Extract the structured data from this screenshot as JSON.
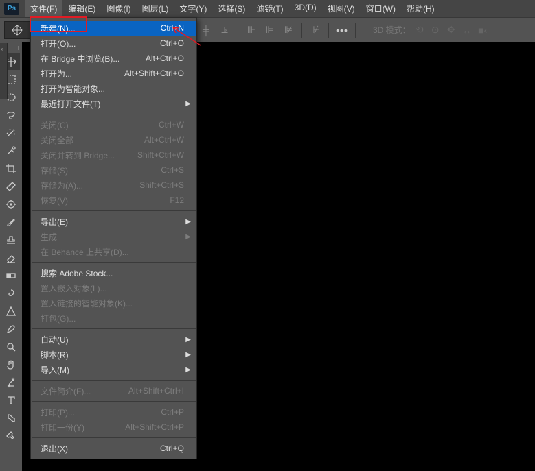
{
  "logo": "Ps",
  "menubar": [
    "文件(F)",
    "编辑(E)",
    "图像(I)",
    "图层(L)",
    "文字(Y)",
    "选择(S)",
    "滤镜(T)",
    "3D(D)",
    "视图(V)",
    "窗口(W)",
    "帮助(H)"
  ],
  "mode3d_label": "3D 模式：",
  "file_menu": {
    "groups": [
      [
        {
          "l": "新建(N)...",
          "s": "Ctrl+N",
          "hover": true
        },
        {
          "l": "打开(O)...",
          "s": "Ctrl+O"
        },
        {
          "l": "在 Bridge 中浏览(B)...",
          "s": "Alt+Ctrl+O"
        },
        {
          "l": "打开为...",
          "s": "Alt+Shift+Ctrl+O"
        },
        {
          "l": "打开为智能对象..."
        },
        {
          "l": "最近打开文件(T)",
          "sub": true
        }
      ],
      [
        {
          "l": "关闭(C)",
          "s": "Ctrl+W",
          "dis": true
        },
        {
          "l": "关闭全部",
          "s": "Alt+Ctrl+W",
          "dis": true
        },
        {
          "l": "关闭并转到 Bridge...",
          "s": "Shift+Ctrl+W",
          "dis": true
        },
        {
          "l": "存储(S)",
          "s": "Ctrl+S",
          "dis": true
        },
        {
          "l": "存储为(A)...",
          "s": "Shift+Ctrl+S",
          "dis": true
        },
        {
          "l": "恢复(V)",
          "s": "F12",
          "dis": true
        }
      ],
      [
        {
          "l": "导出(E)",
          "sub": true
        },
        {
          "l": "生成",
          "sub": true,
          "dis": true
        },
        {
          "l": "在 Behance 上共享(D)...",
          "dis": true
        }
      ],
      [
        {
          "l": "搜索 Adobe Stock..."
        },
        {
          "l": "置入嵌入对象(L)...",
          "dis": true
        },
        {
          "l": "置入链接的智能对象(K)...",
          "dis": true
        },
        {
          "l": "打包(G)...",
          "dis": true
        }
      ],
      [
        {
          "l": "自动(U)",
          "sub": true
        },
        {
          "l": "脚本(R)",
          "sub": true
        },
        {
          "l": "导入(M)",
          "sub": true
        }
      ],
      [
        {
          "l": "文件简介(F)...",
          "s": "Alt+Shift+Ctrl+I",
          "dis": true
        }
      ],
      [
        {
          "l": "打印(P)...",
          "s": "Ctrl+P",
          "dis": true
        },
        {
          "l": "打印一份(Y)",
          "s": "Alt+Shift+Ctrl+P",
          "dis": true
        }
      ],
      [
        {
          "l": "退出(X)",
          "s": "Ctrl+Q"
        }
      ]
    ]
  },
  "tools": [
    "move",
    "marquee",
    "ellipse-marquee",
    "lasso",
    "magic-wand",
    "healing-brush",
    "crop",
    "ruler",
    "spot",
    "brush",
    "stamp",
    "eraser",
    "gradient",
    "smudge",
    "triangle",
    "pen",
    "magnify",
    "hand",
    "path",
    "type",
    "shape",
    "wrench"
  ]
}
